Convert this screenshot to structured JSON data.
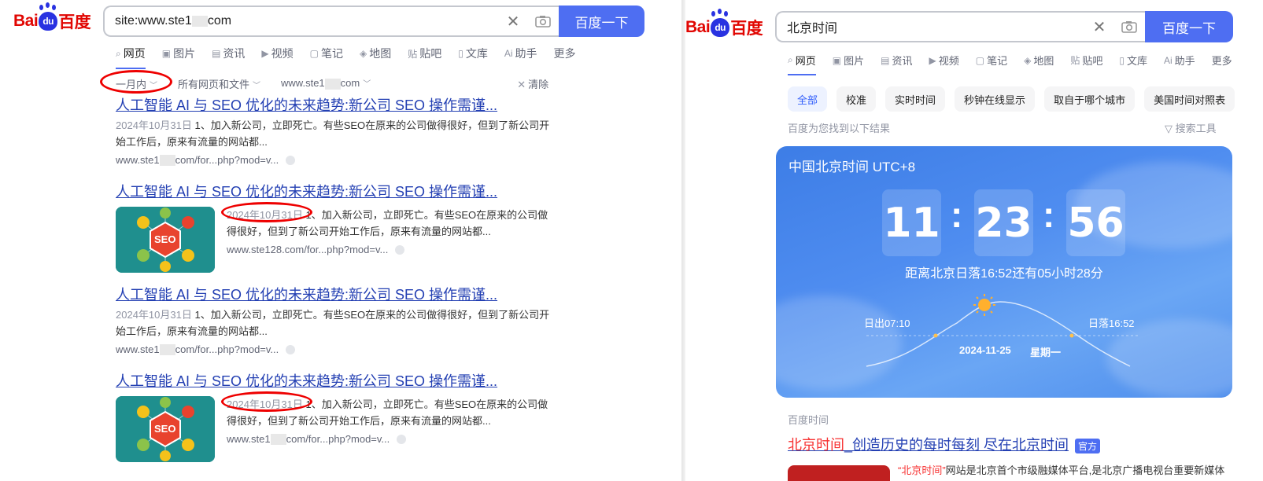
{
  "left": {
    "logo": {
      "bai": "Bai",
      "du": "du",
      "cn": "百度"
    },
    "search": {
      "query": "site:www.ste1",
      "query_tail": "com",
      "button": "百度一下"
    },
    "tabs": [
      {
        "icon": "⌕",
        "label": "网页",
        "active": true
      },
      {
        "icon": "▣",
        "label": "图片"
      },
      {
        "icon": "▤",
        "label": "资讯"
      },
      {
        "icon": "▶",
        "label": "视频"
      },
      {
        "icon": "▢",
        "label": "笔记"
      },
      {
        "icon": "◈",
        "label": "地图"
      },
      {
        "icon": "贴",
        "label": "贴吧"
      },
      {
        "icon": "▯",
        "label": "文库"
      },
      {
        "icon": "Ai",
        "label": "助手"
      },
      {
        "icon": "",
        "label": "更多"
      }
    ],
    "filters": {
      "time": "一月内",
      "type": "所有网页和文件",
      "site_a": "www.ste1",
      "site_b": "com",
      "clear": "清除"
    },
    "results": [
      {
        "title": "人工智能 AI 与 SEO 优化的未来趋势:新公司 SEO 操作需谨...",
        "date": "2024年10月31日",
        "abstract": "1、加入新公司，立即死亡。有些SEO在原来的公司做得很好，但到了新公司开始工作后，原来有流量的网站都...",
        "url_a": "www.ste1",
        "url_b": "com/for...php?mod=v...",
        "has_thumb": false
      },
      {
        "title": "人工智能 AI 与 SEO 优化的未来趋势:新公司 SEO 操作需谨...",
        "date": "2024年10月31日",
        "abstract": "1、加入新公司，立即死亡。有些SEO在原来的公司做得很好，但到了新公司开始工作后，原来有流量的网站都...",
        "url_a": "www.ste128.com/for...php?mod=v...",
        "url_b": "",
        "has_thumb": true
      },
      {
        "title": "人工智能 AI 与 SEO 优化的未来趋势:新公司 SEO 操作需谨...",
        "date": "2024年10月31日",
        "abstract": "1、加入新公司，立即死亡。有些SEO在原来的公司做得很好，但到了新公司开始工作后，原来有流量的网站都...",
        "url_a": "www.ste1",
        "url_b": "com/for...php?mod=v...",
        "has_thumb": false
      },
      {
        "title": "人工智能 AI 与 SEO 优化的未来趋势:新公司 SEO 操作需谨...",
        "date": "2024年10月31日",
        "abstract": "1、加入新公司，立即死亡。有些SEO在原来的公司做得很好，但到了新公司开始工作后，原来有流量的网站都...",
        "url_a": "www.ste1",
        "url_b": "com/for...php?mod=v...",
        "has_thumb": true
      }
    ],
    "thumb_text": "SEO"
  },
  "right": {
    "logo": {
      "bai": "Bai",
      "du": "du",
      "cn": "百度"
    },
    "search": {
      "query": "北京时间",
      "button": "百度一下"
    },
    "tabs": [
      {
        "icon": "⌕",
        "label": "网页",
        "active": true
      },
      {
        "icon": "▣",
        "label": "图片"
      },
      {
        "icon": "▤",
        "label": "资讯"
      },
      {
        "icon": "▶",
        "label": "视频"
      },
      {
        "icon": "▢",
        "label": "笔记"
      },
      {
        "icon": "◈",
        "label": "地图"
      },
      {
        "icon": "贴",
        "label": "贴吧"
      },
      {
        "icon": "▯",
        "label": "文库"
      },
      {
        "icon": "Ai",
        "label": "助手"
      },
      {
        "icon": "",
        "label": "更多"
      }
    ],
    "chips": [
      "全部",
      "校准",
      "实时时间",
      "秒钟在线显示",
      "取自于哪个城市",
      "美国时间对照表"
    ],
    "found": "百度为您找到以下结果",
    "tools": "搜索工具",
    "clock": {
      "title": "中国北京时间 UTC+8",
      "hh": "11",
      "mm": "23",
      "ss": "56",
      "sunset_text": "距离北京日落16:52还有05小时28分",
      "sunrise": "日出07:10",
      "sunset": "日落16:52",
      "date": "2024-11-25",
      "weekday": "星期一"
    },
    "source": "百度时间",
    "result": {
      "title_hl": "北京时间",
      "title_rest": "_创造历史的每时每刻 尽在北京时间",
      "badge": "官方"
    },
    "snippet": {
      "hl": "“北京时间”",
      "rest": "网站是北京首个市级融媒体平台,是北京广播电视台重要新媒体"
    }
  },
  "colors": {
    "brand_blue": "#4e6ef2",
    "brand_red": "#e10602",
    "link": "#2440b3",
    "annotation_red": "#e00000"
  }
}
